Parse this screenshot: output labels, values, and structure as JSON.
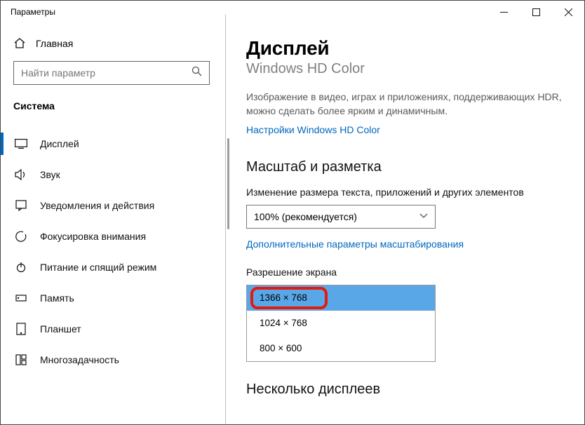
{
  "window": {
    "title": "Параметры"
  },
  "sidebar": {
    "home": "Главная",
    "search_placeholder": "Найти параметр",
    "category": "Система",
    "items": [
      {
        "label": "Дисплей"
      },
      {
        "label": "Звук"
      },
      {
        "label": "Уведомления и действия"
      },
      {
        "label": "Фокусировка внимания"
      },
      {
        "label": "Питание и спящий режим"
      },
      {
        "label": "Память"
      },
      {
        "label": "Планшет"
      },
      {
        "label": "Многозадачность"
      }
    ]
  },
  "content": {
    "heading": "Дисплей",
    "subheading": "Windows HD Color",
    "hd_desc": "Изображение в видео, играх и приложениях, поддерживающих HDR, можно сделать более ярким и динамичным.",
    "hd_link": "Настройки Windows HD Color",
    "scale_heading": "Масштаб и разметка",
    "scale_label": "Изменение размера текста, приложений и других элементов",
    "scale_value": "100% (рекомендуется)",
    "adv_link": "Дополнительные параметры масштабирования",
    "res_label": "Разрешение экрана",
    "res_options": [
      "1366 × 768",
      "1024 × 768",
      "800 × 600"
    ],
    "multi_heading": "Несколько дисплеев"
  }
}
